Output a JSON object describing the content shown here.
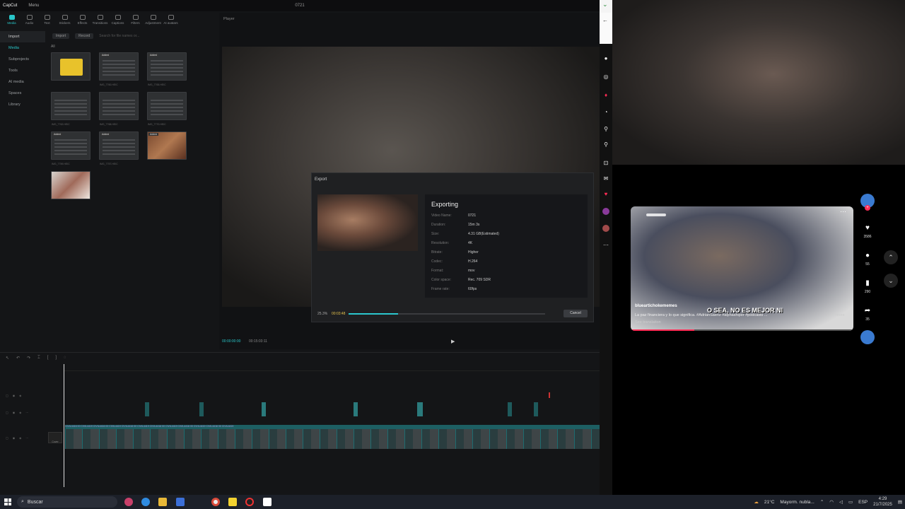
{
  "capcut": {
    "app_name": "CapCut",
    "menu_label": "Menu",
    "window_title": "0721",
    "tools": [
      {
        "label": "Media",
        "icon": "media-icon",
        "active": true
      },
      {
        "label": "Audio",
        "icon": "audio-icon"
      },
      {
        "label": "Text",
        "icon": "text-icon"
      },
      {
        "label": "Stickers",
        "icon": "stickers-icon"
      },
      {
        "label": "Effects",
        "icon": "effects-icon"
      },
      {
        "label": "Transitions",
        "icon": "transitions-icon"
      },
      {
        "label": "Captions",
        "icon": "captions-icon"
      },
      {
        "label": "Filters",
        "icon": "filters-icon"
      },
      {
        "label": "Adjustment",
        "icon": "adjustment-icon"
      },
      {
        "label": "AI avatars",
        "icon": "ai-avatars-icon"
      }
    ],
    "nav": [
      "Import",
      "Media",
      "Subprojects",
      "Tools",
      "AI media",
      "Spaces",
      "Library"
    ],
    "media_tools": {
      "import": "Import",
      "record": "Record",
      "search_placeholder": "Search for file names or..."
    },
    "all_label": "All",
    "thumbs": [
      {
        "label": "",
        "added": "",
        "kind": "folder"
      },
      {
        "label": "IMG_7760.HEIC",
        "added": "Added"
      },
      {
        "label": "IMG_7765.HEIC",
        "added": "Added"
      },
      {
        "label": "IMG_7762.HEIC",
        "added": ""
      },
      {
        "label": "IMG_7768.HEIC",
        "added": ""
      },
      {
        "label": "IMG_7770.HEIC",
        "added": ""
      },
      {
        "label": "IMG_7759.HEIC",
        "added": "Added"
      },
      {
        "label": "IMG_7757.HEIC",
        "added": "Added"
      },
      {
        "label": "",
        "added": "Added"
      },
      {
        "label": "",
        "added": ""
      }
    ],
    "player_label": "Player",
    "player_time": "00:00:00:00",
    "player_duration": "00:15:03:11"
  },
  "export": {
    "title": "Export",
    "status": "Exporting",
    "rows": [
      {
        "k": "Video Name:",
        "v": "0721"
      },
      {
        "k": "Duration:",
        "v": "15m 3s"
      },
      {
        "k": "Size:",
        "v": "4.31 GB(Estimated)"
      },
      {
        "k": "Resolution:",
        "v": "4K"
      },
      {
        "k": "Bitrate:",
        "v": "Higher"
      },
      {
        "k": "Codec:",
        "v": "H.264"
      },
      {
        "k": "Format:",
        "v": "mov"
      },
      {
        "k": "Color space:",
        "v": "Rec. 709 SDR"
      },
      {
        "k": "Frame rate:",
        "v": "60fps"
      }
    ],
    "percent": "25.3%",
    "percent_value": 0.253,
    "elapsed": "00:03:48",
    "cancel": "Cancel"
  },
  "timeline": {
    "cover_label": "Cover",
    "clip_strip_text": "CIVIL4416 00 CIVIL4419 CIVIL4416 00 CIVIL4419 CIVIL4416 00 CIVIL4419 CIVIL4416 00 CIVIL4419 CIVIL4416 00 CIVIL4419 CIVIL4416 00 CIVIL4419"
  },
  "tiktok": {
    "username": "blueartichokememes",
    "description": "La paz financiera y lo que significa. #AdrianSaenz #alphashiper #podcasts ...",
    "more": "more",
    "see_translation": "See translation",
    "caption": "O SEA, NO ES MEJOR NI",
    "likes": "3586",
    "comments": "55",
    "saves": "290",
    "shares": "35"
  },
  "taskbar": {
    "search": "Buscar",
    "weather_temp": "21°C",
    "weather_desc": "Mayorm. nubla...",
    "lang": "ESP",
    "time": "4:29",
    "date": "21/7/2025"
  }
}
